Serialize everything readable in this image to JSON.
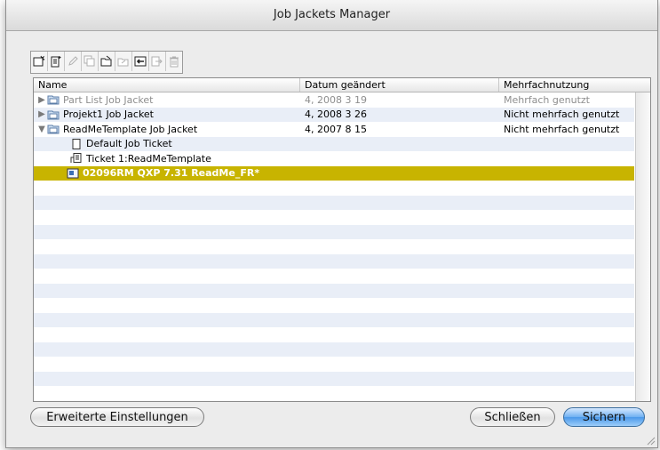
{
  "window": {
    "title": "Job Jackets Manager"
  },
  "toolbar": {
    "buttons": [
      {
        "icon": "new-job-jacket-icon",
        "enabled": true
      },
      {
        "icon": "new-job-ticket-icon",
        "enabled": true
      },
      {
        "icon": "edit-pencil-icon",
        "enabled": false
      },
      {
        "icon": "duplicate-icon",
        "enabled": false
      },
      {
        "icon": "open-folder-icon",
        "enabled": true
      },
      {
        "icon": "folder-link-icon",
        "enabled": false
      },
      {
        "icon": "import-icon",
        "enabled": true
      },
      {
        "icon": "export-icon",
        "enabled": false
      },
      {
        "icon": "trash-icon",
        "enabled": false
      }
    ]
  },
  "list": {
    "columns": [
      "Name",
      "Datum geändert",
      "Mehrfachnutzung"
    ],
    "rows": [
      {
        "name": "Part List Job Jacket",
        "date": "4, 2008 3 19",
        "usage": "Mehrfach genutzt",
        "level": 0,
        "disclosure": "collapsed",
        "icon": "job-jacket-icon",
        "dimmed": true
      },
      {
        "name": "Projekt1 Job Jacket",
        "date": "4, 2008 3 26",
        "usage": "Nicht mehrfach genutzt",
        "level": 0,
        "disclosure": "collapsed",
        "icon": "job-jacket-icon",
        "dimmed": false
      },
      {
        "name": "ReadMeTemplate Job Jacket",
        "date": "4, 2007 8 15",
        "usage": "Nicht mehrfach genutzt",
        "level": 0,
        "disclosure": "expanded",
        "icon": "job-jacket-icon",
        "dimmed": false
      },
      {
        "name": "Default Job Ticket",
        "date": "",
        "usage": "",
        "level": 1,
        "disclosure": "none",
        "icon": "job-ticket-icon",
        "dimmed": false
      },
      {
        "name": "Ticket 1:ReadMeTemplate",
        "date": "",
        "usage": "",
        "level": 1,
        "disclosure": "none",
        "icon": "job-ticket-linked-icon",
        "dimmed": false
      },
      {
        "name": "02096RM QXP 7.31 ReadMe_FR*",
        "date": "",
        "usage": "",
        "level": 2,
        "disclosure": "none",
        "icon": "project-file-icon",
        "dimmed": false,
        "selected": true
      }
    ],
    "empty_rows": 15
  },
  "buttons": {
    "advanced": "Erweiterte Einstellungen",
    "close": "Schließen",
    "save": "Sichern"
  },
  "colors": {
    "selection": "#c8b400",
    "stripe": "#e9eef7",
    "default_button": "#5aa4ee"
  }
}
